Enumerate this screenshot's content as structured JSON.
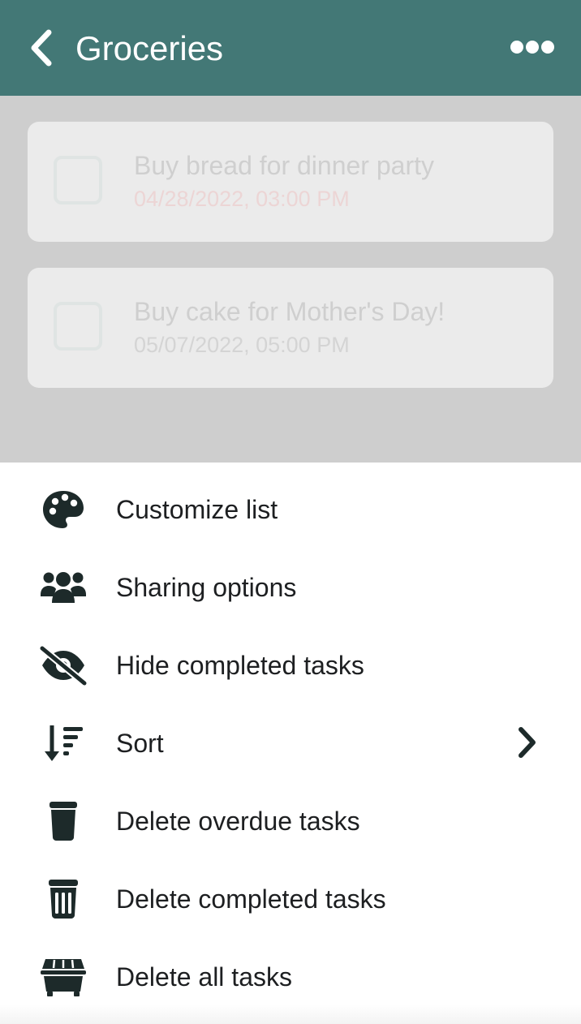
{
  "header": {
    "title": "Groceries",
    "back_icon": "chevron-left-icon",
    "more_icon": "more-horizontal-icon",
    "background": "#437876"
  },
  "tasks": [
    {
      "title": "Buy bread for dinner party",
      "date": "04/28/2022, 03:00 PM",
      "overdue": true
    },
    {
      "title": "Buy cake for Mother's Day!",
      "date": "05/07/2022, 05:00 PM",
      "overdue": false
    }
  ],
  "menu": {
    "items": [
      {
        "label": "Customize list",
        "icon": "palette-icon"
      },
      {
        "label": "Sharing options",
        "icon": "users-icon"
      },
      {
        "label": "Hide completed tasks",
        "icon": "eye-slash-icon"
      },
      {
        "label": "Sort",
        "icon": "sort-icon",
        "submenu_icon": "chevron-right-icon"
      },
      {
        "label": "Delete overdue tasks",
        "icon": "trash-icon"
      },
      {
        "label": "Delete completed tasks",
        "icon": "trash-lines-icon"
      },
      {
        "label": "Delete all tasks",
        "icon": "dumpster-icon"
      }
    ]
  }
}
